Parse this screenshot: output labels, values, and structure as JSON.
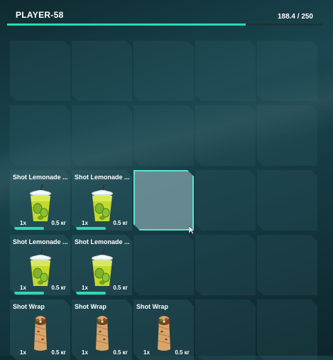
{
  "header": {
    "player": "PLAYER-58",
    "weight": "188.4 / 250",
    "weight_fraction": 0.754,
    "accent": "#2fd8b4"
  },
  "inventory": [
    {
      "row": 3,
      "col": 1,
      "name": "Shot Lemonade ...",
      "qty": "1x",
      "weight": "0.5 кг",
      "icon": "lemonade-cup-icon",
      "durability": true
    },
    {
      "row": 3,
      "col": 2,
      "name": "Shot Lemonade ...",
      "qty": "1x",
      "weight": "0.5 кг",
      "icon": "lemonade-cup-icon",
      "durability": true
    },
    {
      "row": 4,
      "col": 1,
      "name": "Shot Lemonade ...",
      "qty": "1x",
      "weight": "0.5 кг",
      "icon": "lemonade-cup-icon",
      "durability": true
    },
    {
      "row": 4,
      "col": 2,
      "name": "Shot Lemonade ...",
      "qty": "1x",
      "weight": "0.5 кг",
      "icon": "lemonade-cup-icon",
      "durability": true
    },
    {
      "row": 5,
      "col": 1,
      "name": "Shot Wrap",
      "qty": "1x",
      "weight": "0.5 кг",
      "icon": "wrap-icon",
      "durability": false
    },
    {
      "row": 5,
      "col": 2,
      "name": "Shot Wrap",
      "qty": "1x",
      "weight": "0.5 кг",
      "icon": "wrap-icon",
      "durability": false
    },
    {
      "row": 5,
      "col": 3,
      "name": "Shot Wrap",
      "qty": "1x",
      "weight": "0.5 кг",
      "icon": "wrap-icon",
      "durability": false
    }
  ],
  "hovered_slot": {
    "row": 3,
    "col": 3
  }
}
